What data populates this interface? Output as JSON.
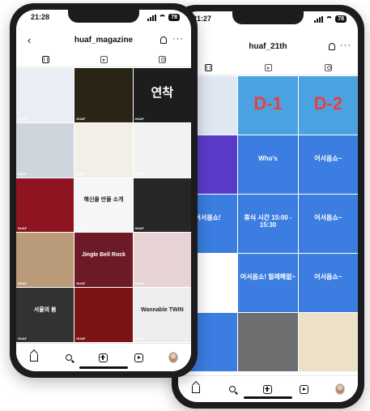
{
  "left_phone": {
    "status_time": "21:28",
    "battery": "78",
    "header_title": "huaf_magazine",
    "back_icon": "‹",
    "more_icon": "···",
    "tile_tag": "HUAF",
    "tiles": [
      {
        "bg": "#e9eef5",
        "text": ""
      },
      {
        "bg": "#2a2417",
        "text": ""
      },
      {
        "bg": "#1d1d1d",
        "text": "연착"
      },
      {
        "bg": "#cfd5dc",
        "text": ""
      },
      {
        "bg": "#f3efe6",
        "text": ""
      },
      {
        "bg": "#f2f2f0",
        "text": ""
      },
      {
        "bg": "#8d1420",
        "text": ""
      },
      {
        "bg": "#f6f6f6",
        "text": "해신을 만들 소개"
      },
      {
        "bg": "#262626",
        "text": ""
      },
      {
        "bg": "#b99b7a",
        "text": ""
      },
      {
        "bg": "#6d1a26",
        "text": "Jingle Bell Rock"
      },
      {
        "bg": "#e7d3d6",
        "text": ""
      },
      {
        "bg": "#323232",
        "text": "서울의 봄"
      },
      {
        "bg": "#7a1414",
        "text": ""
      },
      {
        "bg": "#ededed",
        "text": "Wannable TWIN"
      }
    ]
  },
  "right_phone": {
    "status_time": "21:27",
    "header_title": "huaf_21th",
    "tiles": [
      {
        "bg": "#dfe7f3",
        "text": ""
      },
      {
        "bg": "#4aa3e0",
        "text": "D-1"
      },
      {
        "bg": "#4aa3e0",
        "text": "D-2"
      },
      {
        "bg": "#5a3bc8",
        "text": ""
      },
      {
        "bg": "#3b7de0",
        "text": "Who's"
      },
      {
        "bg": "#3b7de0",
        "text": "어서옵쇼~"
      },
      {
        "bg": "#3b7de0",
        "text": "어서옵쇼!"
      },
      {
        "bg": "#3b7de0",
        "text": "휴식 시간 15:00 - 15:30"
      },
      {
        "bg": "#3b7de0",
        "text": "어서옵쇼~"
      },
      {
        "bg": "#ffffff",
        "text": ""
      },
      {
        "bg": "#3b7de0",
        "text": "어서옵쇼! 헐레해없~"
      },
      {
        "bg": "#3b7de0",
        "text": "어서옵쇼~"
      },
      {
        "bg": "#3b7de0",
        "text": ""
      },
      {
        "bg": "#6c6e6f",
        "text": ""
      },
      {
        "bg": "#ede0c8",
        "text": ""
      }
    ]
  },
  "icons": {
    "tab_grid": "grid-icon",
    "tab_reels": "reels-icon",
    "tab_tagged": "tagged-icon",
    "nav_home": "home-icon",
    "nav_search": "search-icon",
    "nav_create": "create-icon",
    "nav_reels": "reels-icon",
    "nav_profile": "profile-icon"
  }
}
